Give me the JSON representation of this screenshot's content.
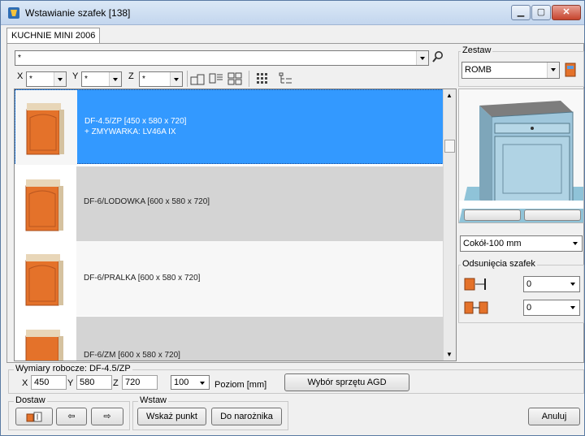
{
  "window": {
    "title": "Wstawianie szafek [138]"
  },
  "tab": {
    "label": "KUCHNIE MINI 2006"
  },
  "filter": {
    "category_value": "*",
    "x_label": "X",
    "y_label": "Y",
    "z_label": "Z",
    "x_value": "*",
    "y_value": "*",
    "z_value": "*"
  },
  "zestaw": {
    "group_label": "Zestaw",
    "value": "ROMB"
  },
  "items": [
    {
      "name": "DF-4.5/ZP  [450 x 580 x 720]",
      "extra": "+ ZMYWARKA: LV46A IX",
      "selected": true
    },
    {
      "name": "DF-6/LODOWKA  [600 x 580 x 720]",
      "extra": "",
      "selected": false
    },
    {
      "name": "DF-6/PRALKA  [600 x 580 x 720]",
      "extra": "",
      "selected": false
    },
    {
      "name": "DF-6/ZM  [600 x 580 x 720]",
      "extra": "",
      "selected": false
    }
  ],
  "preview": {
    "cokol_value": "Cokół-100 mm"
  },
  "odsuniecia": {
    "group_label": "Odsunięcia szafek",
    "value1": "0",
    "value2": "0"
  },
  "wymiary": {
    "group_label": "Wymiary robocze: DF-4.5/ZP",
    "x_label": "X",
    "y_label": "Y",
    "z_label": "Z",
    "x_value": "450",
    "y_value": "580",
    "z_value": "720",
    "poziom_value": "100",
    "poziom_label": "Poziom [mm]",
    "agd_button": "Wybór sprzętu AGD"
  },
  "dostaw": {
    "group_label": "Dostaw"
  },
  "wstaw": {
    "group_label": "Wstaw",
    "wskaz_button": "Wskaż punkt",
    "naroznik_button": "Do narożnika"
  },
  "anuluj_button": "Anuluj",
  "colors": {
    "selection": "#3399ff",
    "row_alt": "#d4d4d4",
    "door": "#e4722a"
  }
}
